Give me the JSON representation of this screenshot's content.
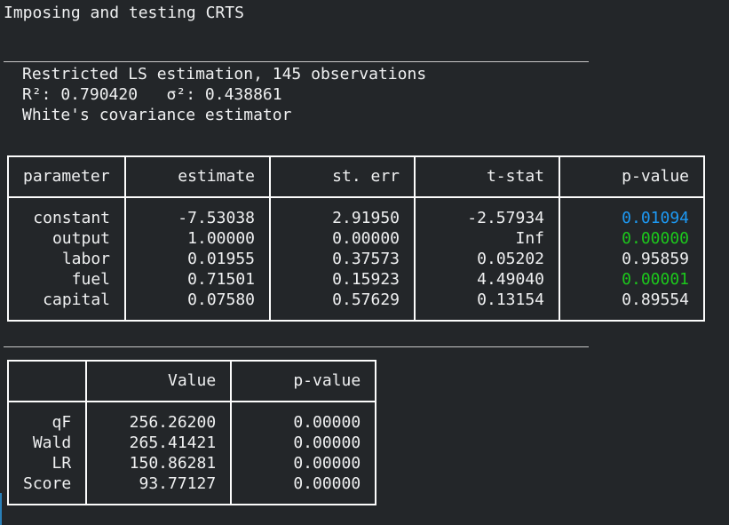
{
  "title": "Imposing and testing CRTS",
  "summary": {
    "line1": "Restricted LS estimation, 145 observations",
    "line2": "R²: 0.790420   σ²: 0.438861",
    "line3": "White's covariance estimator"
  },
  "estimates_table": {
    "headers": [
      "parameter",
      "estimate",
      "st. err",
      "t-stat",
      "p-value"
    ],
    "rows": [
      {
        "parameter": "constant",
        "estimate": "-7.53038",
        "st_err": "2.91950",
        "t_stat": "-2.57934",
        "p_value": "0.01094",
        "p_color": "#1d99f3"
      },
      {
        "parameter": "output",
        "estimate": "1.00000",
        "st_err": "0.00000",
        "t_stat": "Inf",
        "p_value": "0.00000",
        "p_color": "#1cc81c"
      },
      {
        "parameter": "labor",
        "estimate": "0.01955",
        "st_err": "0.37573",
        "t_stat": "0.05202",
        "p_value": "0.95859",
        "p_color": "#eff0f1"
      },
      {
        "parameter": "fuel",
        "estimate": "0.71501",
        "st_err": "0.15923",
        "t_stat": "4.49040",
        "p_value": "0.00001",
        "p_color": "#1cc81c"
      },
      {
        "parameter": "capital",
        "estimate": "0.07580",
        "st_err": "0.57629",
        "t_stat": "0.13154",
        "p_value": "0.89554",
        "p_color": "#eff0f1"
      }
    ]
  },
  "tests_table": {
    "headers": [
      "",
      "Value",
      "p-value"
    ],
    "rows": [
      {
        "test": "qF",
        "value": "256.26200",
        "p_value": "0.00000"
      },
      {
        "test": "Wald",
        "value": "265.41421",
        "p_value": "0.00000"
      },
      {
        "test": "LR",
        "value": "150.86281",
        "p_value": "0.00000"
      },
      {
        "test": "Score",
        "value": "93.77127",
        "p_value": "0.00000"
      }
    ]
  }
}
